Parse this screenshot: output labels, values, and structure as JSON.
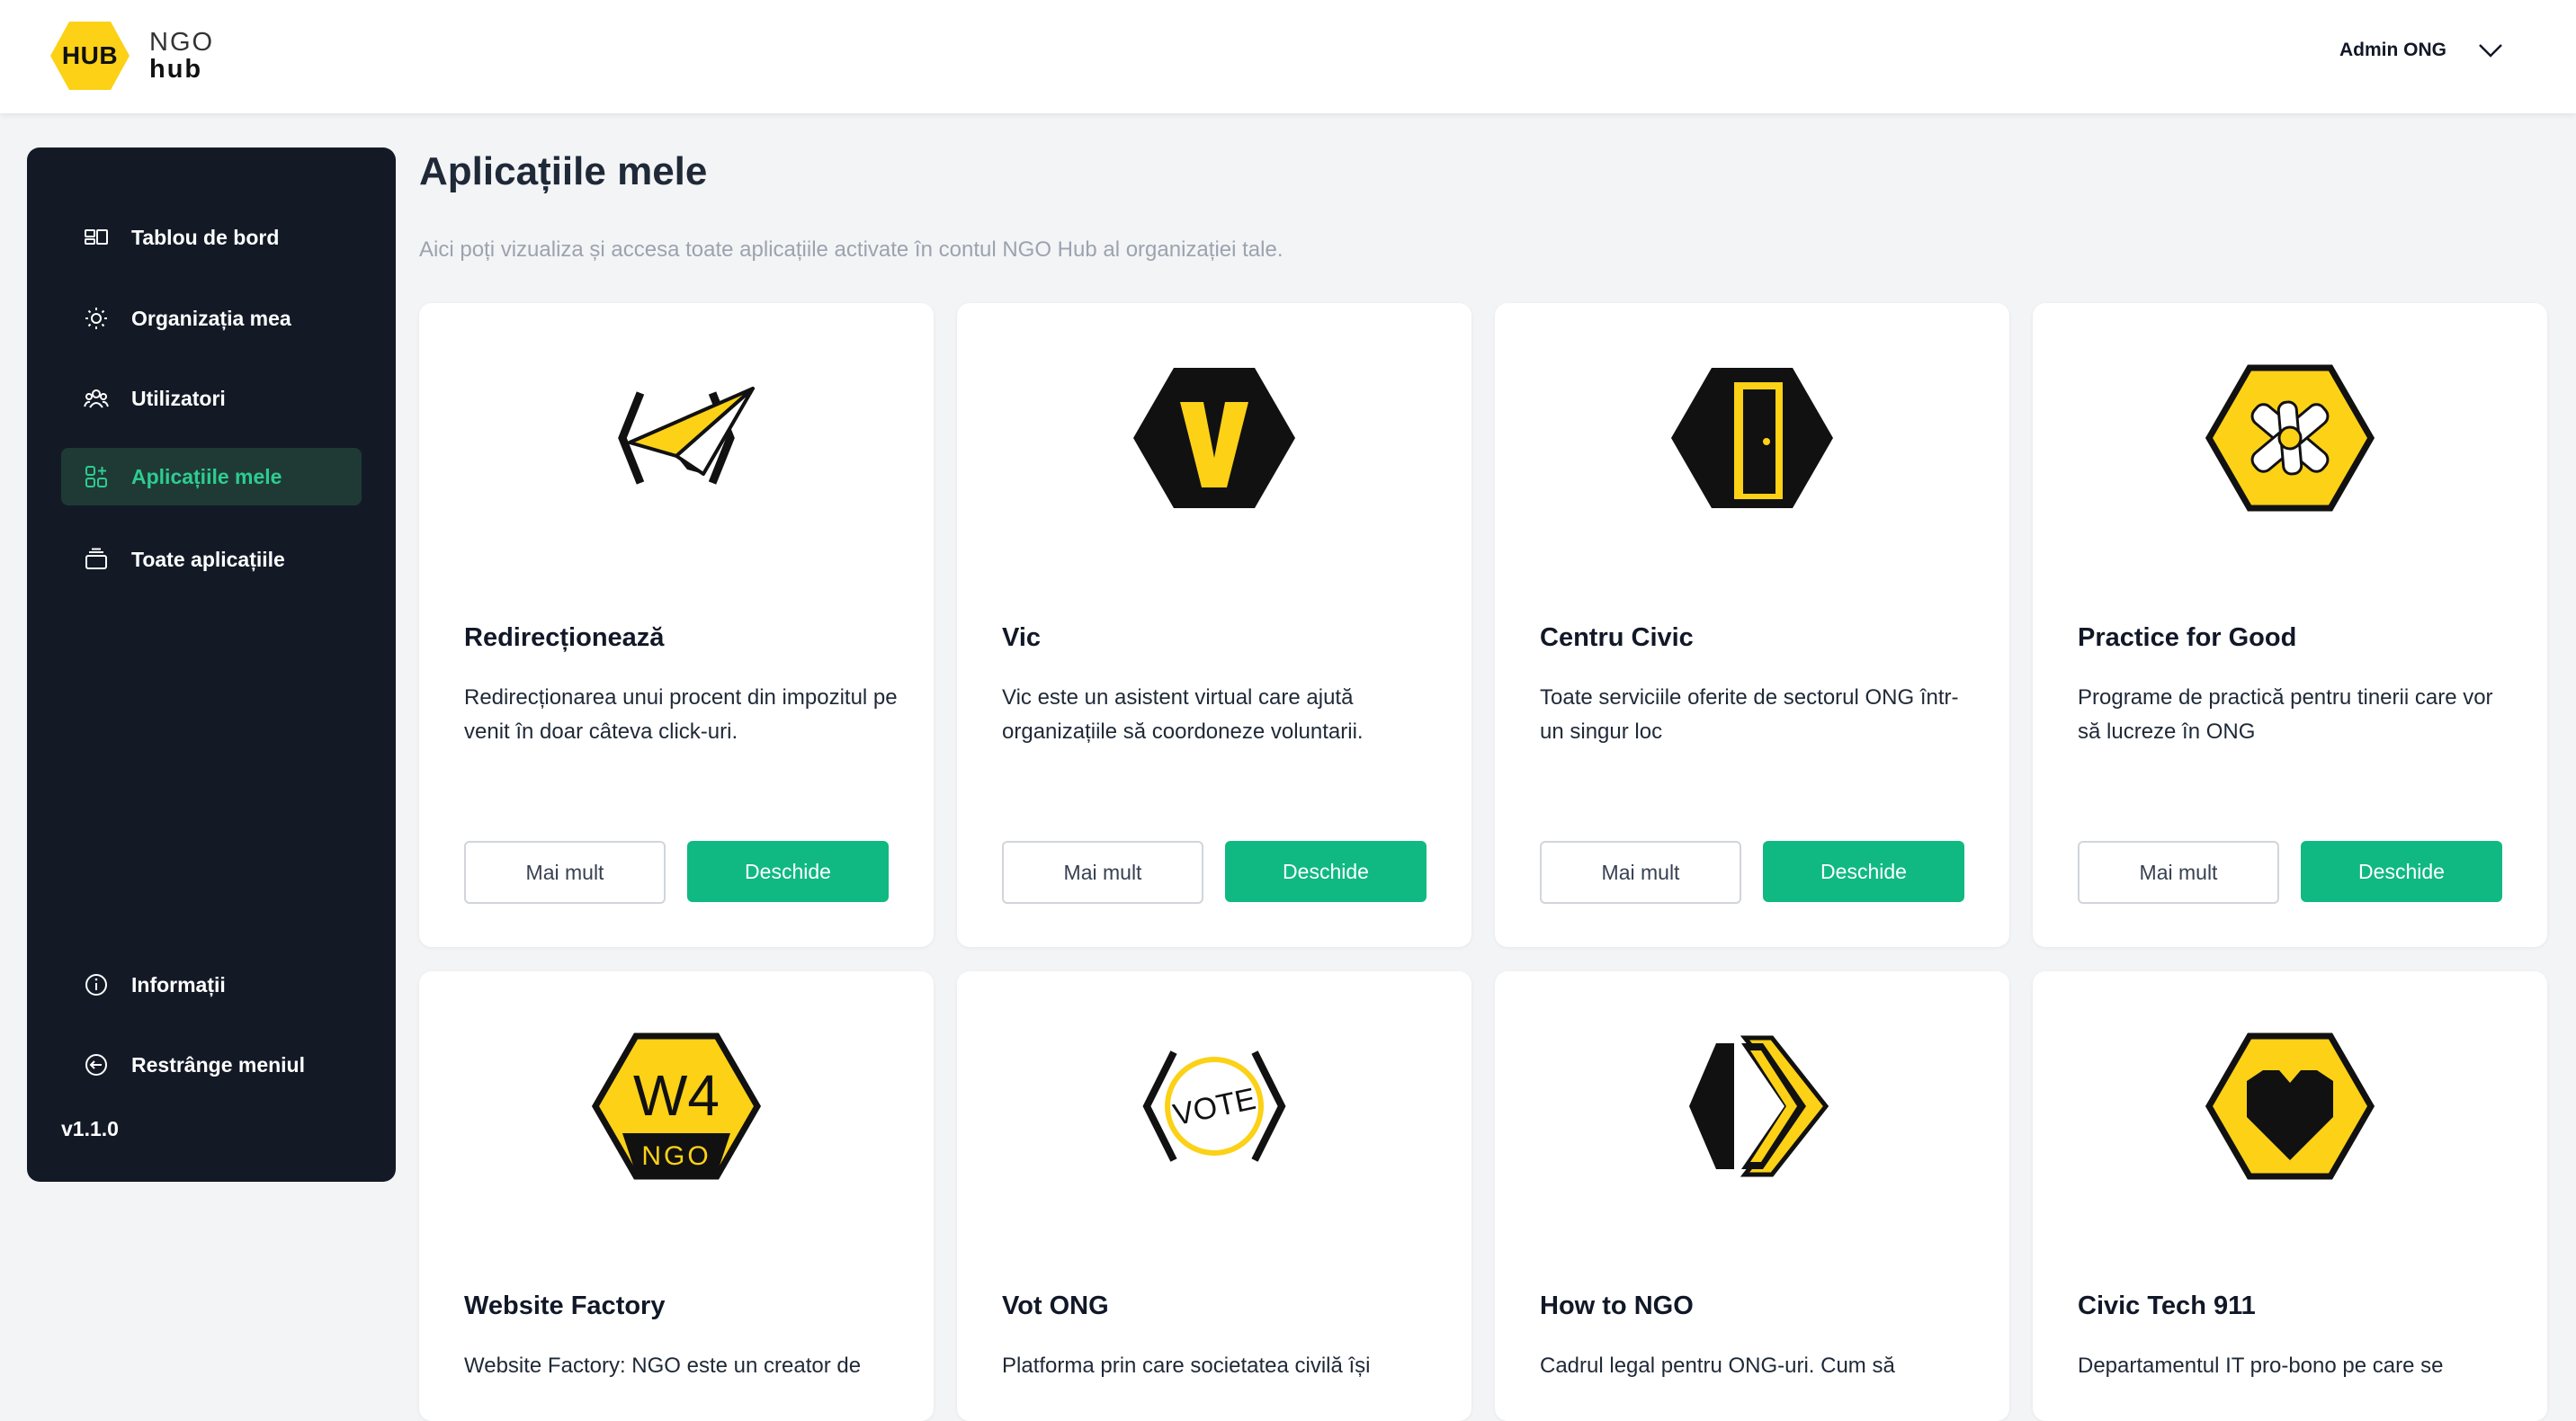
{
  "colors": {
    "accent": "#10b981",
    "sidebar_bg": "#131a26",
    "brand_yellow": "#fcd116",
    "active_bg": "#1f3a35",
    "active_text": "#2ecc91"
  },
  "header": {
    "logo_badge": "HUB",
    "logo_line1": "NGO",
    "logo_line2": "hub",
    "user_name": "Admin ONG"
  },
  "sidebar": {
    "items": [
      {
        "label": "Tablou de bord",
        "icon": "dashboard-icon",
        "active": false
      },
      {
        "label": "Organizația mea",
        "icon": "sun-icon",
        "active": false
      },
      {
        "label": "Utilizatori",
        "icon": "users-icon",
        "active": false
      },
      {
        "label": "Aplicațiile mele",
        "icon": "apps-grid-icon",
        "active": true
      },
      {
        "label": "Toate aplicațiile",
        "icon": "stack-icon",
        "active": false
      }
    ],
    "bottom_items": [
      {
        "label": "Informații",
        "icon": "info-icon"
      },
      {
        "label": "Restrânge meniul",
        "icon": "arrow-left-circle-icon"
      }
    ],
    "version": "v1.1.0"
  },
  "main": {
    "title": "Aplicațiile mele",
    "subtitle": "Aici poți vizualiza și accesa toate aplicațiile activate în contul NGO Hub al organizației tale.",
    "more_label": "Mai mult",
    "open_label": "Deschide",
    "apps": [
      {
        "name": "Redirecționează",
        "description": "Redirecționarea unui procent din impozitul pe venit în doar câteva click-uri.",
        "icon": "paper-plane-icon"
      },
      {
        "name": "Vic",
        "description": "Vic este un asistent virtual care ajută organizațiile să coordoneze voluntarii.",
        "icon": "vic-v-icon"
      },
      {
        "name": "Centru Civic",
        "description": "Toate serviciile oferite de sectorul ONG într-un singur loc",
        "icon": "door-icon"
      },
      {
        "name": "Practice for Good",
        "description": "Programe de practică pentru tinerii care vor să lucreze în ONG",
        "icon": "hands-icon"
      },
      {
        "name": "Website Factory",
        "description": "Website Factory: NGO este un creator de",
        "icon": "w4-ngo-icon",
        "badge_top": "W4",
        "badge_bottom": "NGO"
      },
      {
        "name": "Vot ONG",
        "description": "Platforma prin care societatea civilă își",
        "icon": "vote-icon",
        "badge": "VOTE"
      },
      {
        "name": "How to NGO",
        "description": "Cadrul legal pentru ONG-uri. Cum să",
        "icon": "chevrons-icon"
      },
      {
        "name": "Civic Tech 911",
        "description": "Departamentul IT pro-bono pe care se",
        "icon": "heart-icon"
      }
    ]
  }
}
